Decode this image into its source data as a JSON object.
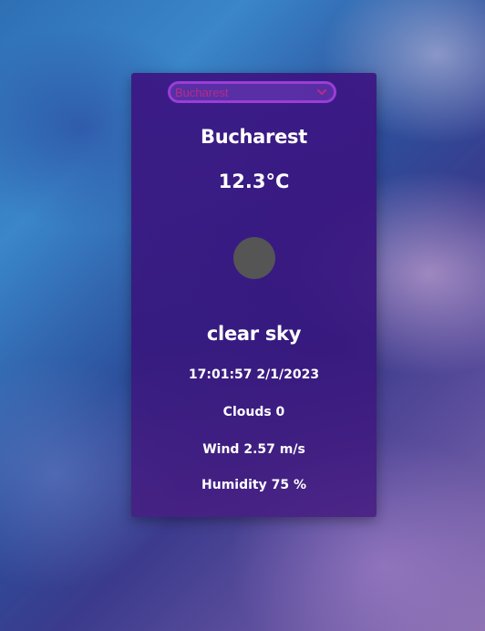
{
  "city_select": {
    "selected": "Bucharest",
    "icon": "chevron-down-icon"
  },
  "weather": {
    "city": "Bucharest",
    "temperature": "12.3°C",
    "icon": "weather-icon",
    "description": "clear sky",
    "datetime": "17:01:57 2/1/2023",
    "clouds": "Clouds 0",
    "wind": "Wind 2.57 m/s",
    "humidity": "Humidity 75 %"
  },
  "colors": {
    "card": "#3c1482",
    "select_border": "#9b3dd6",
    "select_text": "#b52b8c",
    "icon_placeholder": "#555555",
    "text": "#ffffff"
  }
}
